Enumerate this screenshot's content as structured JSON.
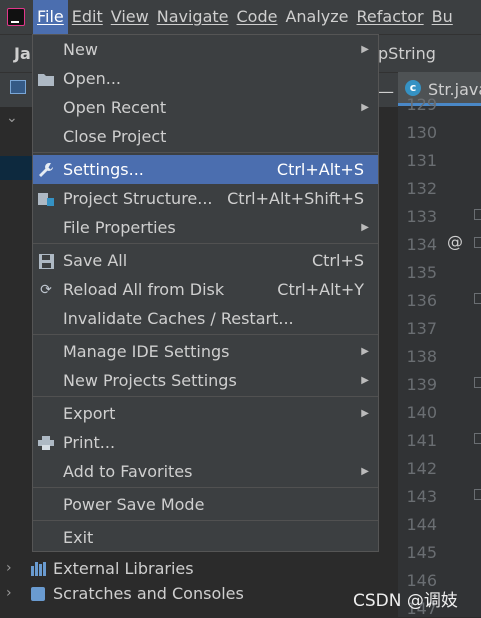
{
  "menubar": {
    "items": [
      "File",
      "Edit",
      "View",
      "Navigate",
      "Code",
      "Analyze",
      "Refactor",
      "Bu"
    ]
  },
  "background": {
    "project_title": "Ja",
    "tab_text": "pString",
    "dash": "—",
    "editor_tab": "Str.java",
    "line_numbers": [
      "129",
      "130",
      "131",
      "132",
      "133",
      "134",
      "135",
      "136",
      "137",
      "138",
      "139",
      "140",
      "141",
      "142",
      "143",
      "144",
      "145",
      "146",
      "147"
    ],
    "at_marker": "@",
    "tree": {
      "external_libraries": "External Libraries",
      "scratches": "Scratches and Consoles"
    },
    "watermark": "CSDN @调妓"
  },
  "file_menu": {
    "new": "New",
    "open": "Open...",
    "open_recent": "Open Recent",
    "close_project": "Close Project",
    "settings": "Settings...",
    "settings_shortcut": "Ctrl+Alt+S",
    "project_structure": "Project Structure...",
    "project_structure_shortcut": "Ctrl+Alt+Shift+S",
    "file_properties": "File Properties",
    "save_all": "Save All",
    "save_all_shortcut": "Ctrl+S",
    "reload_all": "Reload All from Disk",
    "reload_all_shortcut": "Ctrl+Alt+Y",
    "invalidate_caches": "Invalidate Caches / Restart...",
    "manage_ide_settings": "Manage IDE Settings",
    "new_projects_settings": "New Projects Settings",
    "export": "Export",
    "print": "Print...",
    "add_to_favorites": "Add to Favorites",
    "power_save_mode": "Power Save Mode",
    "exit": "Exit"
  },
  "colors": {
    "menu_bg": "#3c3f41",
    "selection": "#4b6eaf",
    "editor_bg": "#2b2b2b"
  }
}
